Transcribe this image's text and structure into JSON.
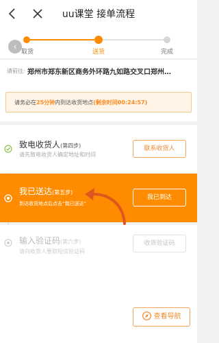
{
  "header": {
    "title": "uu课堂 接单流程",
    "back_icon": "chevron-left-icon",
    "close_icon": "close-icon"
  },
  "progress": {
    "prev_glyph": "‹",
    "steps": [
      {
        "label": "取货",
        "state": "done"
      },
      {
        "label": "送货",
        "state": "active"
      },
      {
        "label": "完成",
        "state": "pending"
      }
    ],
    "accent": "#ff8c00"
  },
  "address": {
    "prefix": "请前往:",
    "text": "郑州市郑东新区商务外环路九如路交叉口郑州…"
  },
  "notice": {
    "before": "请务必在",
    "minutes": "25分钟",
    "after": "内到达收货地点",
    "remaining": "(剩余时间00:24:57)"
  },
  "tasks": [
    {
      "title": "致电收货人",
      "step": "(第四步)",
      "desc": "请先致电收货人确定地址和时间",
      "button": "联系收货人",
      "state": "done"
    },
    {
      "title": "我已送达",
      "step": "(第五步)",
      "desc": "到达收货地点后点击“我已送达”",
      "button": "我已到达",
      "state": "active"
    },
    {
      "title": "输入验证码",
      "step": "(第六步)",
      "desc": "请向收货人要取短信验证码",
      "button": "收货验证码",
      "state": "disabled"
    }
  ],
  "navigation": {
    "label": "查看导航",
    "icon": "navigation-compass-icon"
  },
  "colors": {
    "accent": "#ff8c00",
    "done": "#8bc34a",
    "notice_bg": "#fff4e6",
    "arrow": "#e0561f"
  }
}
